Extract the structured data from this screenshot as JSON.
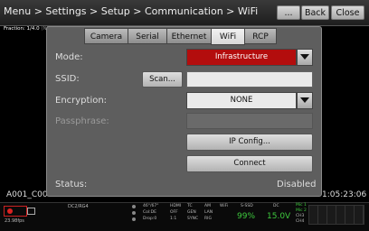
{
  "topbar": {
    "breadcrumb": "Menu > Settings > Setup > Communication > WiFi",
    "ellipsis_label": "...",
    "back_label": "Back",
    "close_label": "Close"
  },
  "viewfinder": {
    "fraction_label": "Fraction: 1/4.0",
    "fraction_note": "(ND Only)",
    "clip_name": "A001_C00",
    "timecode": "1:05:23:06"
  },
  "tabs": [
    {
      "label": "Camera",
      "active": false
    },
    {
      "label": "Serial",
      "active": false
    },
    {
      "label": "Ethernet",
      "active": false
    },
    {
      "label": "WiFi",
      "active": true
    },
    {
      "label": "RCP",
      "active": false
    }
  ],
  "form": {
    "mode_label": "Mode:",
    "mode_value": "Infrastructure",
    "ssid_label": "SSID:",
    "scan_label": "Scan...",
    "ssid_value": "",
    "encryption_label": "Encryption:",
    "encryption_value": "NONE",
    "passphrase_label": "Passphrase:",
    "passphrase_value": "",
    "ip_config_label": "IP Config...",
    "connect_label": "Connect",
    "status_label": "Status:",
    "status_value": "Disabled"
  },
  "colors": {
    "mode_select_bg": "#b30d0d",
    "dialog_bg": "#5e5e5e",
    "status_green": "#3ec93e"
  },
  "bottom": {
    "fps": "23.98fps",
    "sensor": "DC2/RG4",
    "shutter": "46°/67°",
    "col": "Col:DE",
    "drop": "Drop:0",
    "row1": [
      "HDMI",
      "TC",
      "AM",
      "WiFi"
    ],
    "row2": [
      "OFF",
      "GEN",
      "LAN"
    ],
    "row3": [
      "1:1",
      "SYNC",
      "RIG"
    ],
    "media_label": "S-SSD",
    "media_value": "99%",
    "power_label": "DC",
    "power_value": "15.0V",
    "audio_labels": [
      "Mic 1",
      "Mic 2",
      "CH3",
      "CH4"
    ]
  }
}
